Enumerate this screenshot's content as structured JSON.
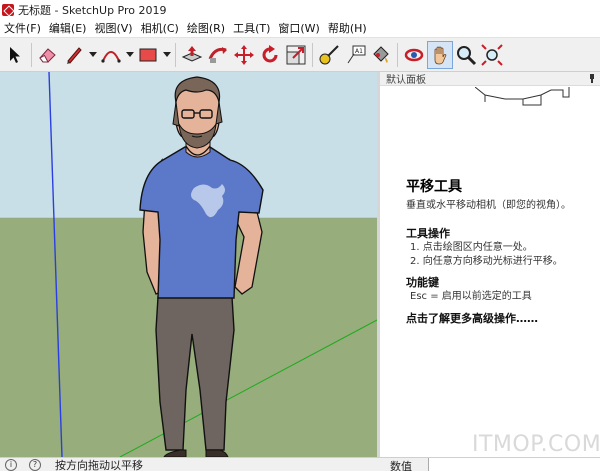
{
  "window": {
    "title": "无标题 - SketchUp Pro 2019"
  },
  "menu": [
    "文件(F)",
    "编辑(E)",
    "视图(V)",
    "相机(C)",
    "绘图(R)",
    "工具(T)",
    "窗口(W)",
    "帮助(H)"
  ],
  "toolbar": {
    "icons": [
      "select-arrow-icon",
      "eraser-icon",
      "pencil-line-icon",
      "arc-icon",
      "rectangle-icon",
      "push-pull-icon",
      "follow-me-icon",
      "move-icon",
      "rotate-icon",
      "scale-icon",
      "tape-measure-icon",
      "text-icon",
      "paint-bucket-icon",
      "orbit-icon",
      "pan-hand-icon",
      "zoom-icon",
      "zoom-extents-icon"
    ],
    "active": "pan-hand-icon"
  },
  "tray": {
    "title": "默认面板",
    "heading": "平移工具",
    "description": "垂直或水平移动相机（即您的视角）。",
    "sections": [
      {
        "title": "工具操作",
        "steps": [
          "1. 点击绘图区内任意一处。",
          "2. 向任意方向移动光标进行平移。"
        ]
      },
      {
        "title": "功能键",
        "steps": [
          "Esc = 启用以前选定的工具"
        ]
      }
    ],
    "more": "点击了解更多高级操作……"
  },
  "status": {
    "hint": "按方向拖动以平移",
    "measurements_label": "数值"
  },
  "watermark": "ITMOP.COM",
  "colors": {
    "sky": "#c8dfe8",
    "ground": "#97ad7b",
    "shirt": "#5c78c8",
    "pants": "#6e6560"
  }
}
